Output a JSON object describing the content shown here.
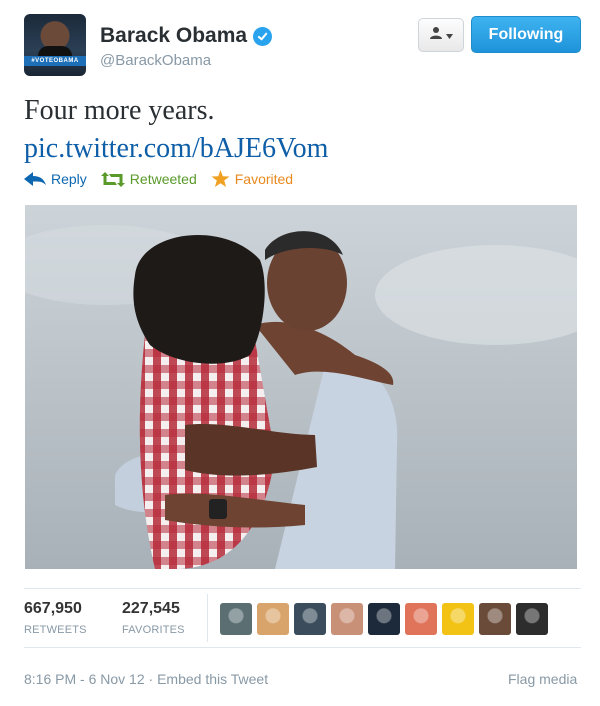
{
  "user": {
    "display_name": "Barack Obama",
    "handle": "@BarackObama",
    "avatar_banner": "#VOTEOBAMA",
    "verified": true
  },
  "buttons": {
    "follow_label": "Following"
  },
  "tweet": {
    "text": "Four more years.",
    "link": "pic.twitter.com/bAJE6Vom"
  },
  "actions": {
    "reply": "Reply",
    "retweeted": "Retweeted",
    "favorited": "Favorited"
  },
  "stats": {
    "retweets_count": "667,950",
    "retweets_label": "RETWEETS",
    "favorites_count": "227,545",
    "favorites_label": "FAVORITES"
  },
  "meta": {
    "timestamp": "8:16 PM - 6 Nov 12",
    "separator": "·",
    "embed": "Embed this Tweet",
    "flag_media": "Flag media"
  },
  "colors": {
    "follow_button": "#2ba2ea",
    "link": "#0e5ea8",
    "retweet_green": "#5a9a2b",
    "favorite_orange": "#e8891e",
    "verified_blue": "#2aa3ef"
  },
  "favoriter_avatars": [
    {
      "bg": "#5b6f73"
    },
    {
      "bg": "#d8a46b"
    },
    {
      "bg": "#3b4d5c"
    },
    {
      "bg": "#c99078"
    },
    {
      "bg": "#1d2a3b"
    },
    {
      "bg": "#e0745a"
    },
    {
      "bg": "#f2c315"
    },
    {
      "bg": "#6a4b3a"
    },
    {
      "bg": "#2d2d2d"
    }
  ]
}
